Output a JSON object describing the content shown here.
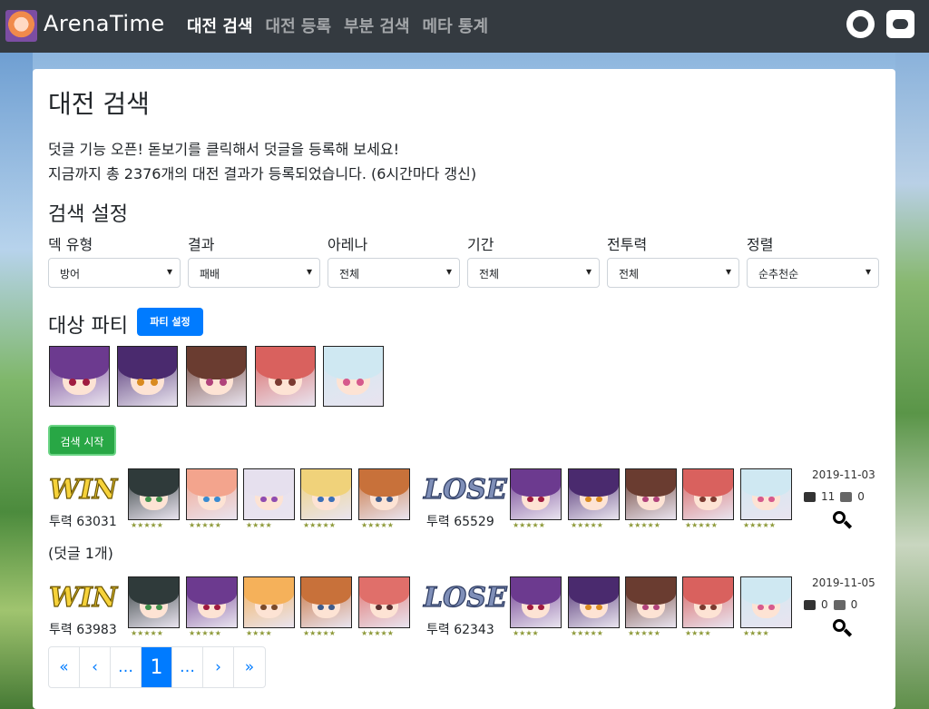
{
  "brand": "ArenaTime",
  "nav": [
    "대전 검색",
    "대전 등록",
    "부분 검색",
    "메타 통계"
  ],
  "page_title": "대전 검색",
  "notice_line1": "덧글 기능 오픈! 돋보기를 클릭해서 덧글을 등록해 보세요!",
  "notice_line2": "지금까지 총 2376개의 대전 결과가 등록되었습니다. (6시간마다 갱신)",
  "search_settings": "검색 설정",
  "filters": [
    {
      "label": "덱 유형",
      "value": "방어"
    },
    {
      "label": "결과",
      "value": "패배"
    },
    {
      "label": "아레나",
      "value": "전체"
    },
    {
      "label": "기간",
      "value": "전체"
    },
    {
      "label": "전투력",
      "value": "전체"
    },
    {
      "label": "정렬",
      "value": "순추천순"
    }
  ],
  "target_party": "대상 파티",
  "party_button": "파티 설정",
  "search_button": "검색 시작",
  "target_party_chars": [
    {
      "hair": "#6c3a8f",
      "eye": "#a01b40"
    },
    {
      "hair": "#4a2a6e",
      "eye": "#d98a1f"
    },
    {
      "hair": "#6a3c30",
      "eye": "#b0427a"
    },
    {
      "hair": "#d9615e",
      "eye": "#7a3a30"
    },
    {
      "hair": "#cfe8f2",
      "eye": "#d65a8c"
    }
  ],
  "results": [
    {
      "attacker_result": "WIN",
      "attacker_power": "투력 63031",
      "attacker": [
        {
          "hair": "#2f3a3a",
          "eye": "#3e8f4a",
          "stars": "★★★★★"
        },
        {
          "hair": "#f3a48d",
          "eye": "#3a8bd0",
          "stars": "★★★★★"
        },
        {
          "hair": "#e6e0ee",
          "eye": "#8f4cb0",
          "stars": "★★★★"
        },
        {
          "hair": "#f0d27a",
          "eye": "#3b6fb7",
          "stars": "★★★★★"
        },
        {
          "hair": "#c8713a",
          "eye": "#3f5b8a",
          "stars": "★★★★★"
        }
      ],
      "defender_result": "LOSE",
      "defender_power": "투력 65529",
      "defender": [
        {
          "hair": "#6c3a8f",
          "eye": "#a01b40",
          "stars": "★★★★★"
        },
        {
          "hair": "#4a2a6e",
          "eye": "#d98a1f",
          "stars": "★★★★★"
        },
        {
          "hair": "#6a3c30",
          "eye": "#b0427a",
          "stars": "★★★★★"
        },
        {
          "hair": "#d9615e",
          "eye": "#7a3a30",
          "stars": "★★★★★"
        },
        {
          "hair": "#cfe8f2",
          "eye": "#d65a8c",
          "stars": "★★★★★"
        }
      ],
      "date": "2019-11-03",
      "up": "11",
      "down": "0"
    },
    {
      "attacker_result": "WIN",
      "attacker_power": "투력 63983",
      "attacker": [
        {
          "hair": "#2f3a3a",
          "eye": "#3e8f4a",
          "stars": "★★★★★"
        },
        {
          "hair": "#6c3a8f",
          "eye": "#a01b40",
          "stars": "★★★★★"
        },
        {
          "hair": "#f5b15a",
          "eye": "#7a4a2a",
          "stars": "★★★★"
        },
        {
          "hair": "#c8713a",
          "eye": "#3f5b8a",
          "stars": "★★★★★"
        },
        {
          "hair": "#e06f6a",
          "eye": "#5a3030",
          "stars": "★★★★★"
        }
      ],
      "defender_result": "LOSE",
      "defender_power": "투력 62343",
      "defender": [
        {
          "hair": "#6c3a8f",
          "eye": "#a01b40",
          "stars": "★★★★"
        },
        {
          "hair": "#4a2a6e",
          "eye": "#d98a1f",
          "stars": "★★★★★"
        },
        {
          "hair": "#6a3c30",
          "eye": "#b0427a",
          "stars": "★★★★★"
        },
        {
          "hair": "#d9615e",
          "eye": "#7a3a30",
          "stars": "★★★★"
        },
        {
          "hair": "#cfe8f2",
          "eye": "#d65a8c",
          "stars": "★★★★"
        }
      ],
      "date": "2019-11-05",
      "up": "0",
      "down": "0"
    }
  ],
  "comment_count": "(덧글 1개)",
  "pagination": [
    "«",
    "‹",
    "…",
    "1",
    "…",
    "›",
    "»"
  ]
}
